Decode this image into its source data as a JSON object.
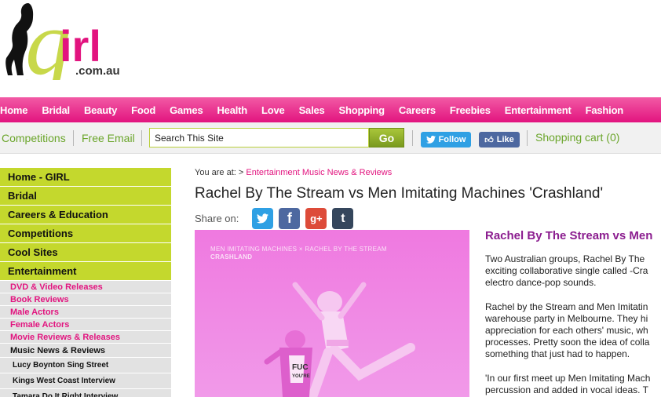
{
  "logo": {
    "letters": "girl",
    "domain": ".com.au",
    "icon": "silhouette-logo-icon"
  },
  "main_nav": [
    "Home",
    "Bridal",
    "Beauty",
    "Food",
    "Games",
    "Health",
    "Love",
    "Sales",
    "Shopping",
    "Careers",
    "Freebies",
    "Entertainment",
    "Fashion"
  ],
  "secondary": {
    "competitions": "Competitions",
    "free_email": "Free Email",
    "search_value": "Search This Site",
    "go": "Go",
    "twitter": "Follow",
    "facebook": "Like",
    "cart": "Shopping cart (0)"
  },
  "sidebar": {
    "items": [
      "Home - GIRL",
      "Bridal",
      "Careers & Education",
      "Competitions",
      "Cool Sites",
      "Entertainment"
    ],
    "sub": [
      "DVD & Video Releases",
      "Book Reviews",
      "Male Actors",
      "Female Actors",
      "Movie Reviews & Releases"
    ],
    "active_sub": "Music News & Reviews",
    "sub2": [
      "Lucy Boynton Sing Street",
      "Kings West Coast Interview",
      "Tamara Do It Right Interview"
    ]
  },
  "breadcrumb": {
    "prefix": "You are at: >",
    "link": "Entertainment Music News & Reviews"
  },
  "article": {
    "title": "Rachel By The Stream vs Men Imitating Machines 'Crashland'",
    "share_label": "Share on:",
    "image_caption_1": "MEN IMITATING MACHINES × RACHEL BY THE STREAM",
    "image_caption_2": "CRASHLAND",
    "image_shirt_text_1": "FUC",
    "image_shirt_text_2": "YOU'RE",
    "side_title": "Rachel By The Stream vs Men",
    "p1": [
      "Two Australian groups, Rachel By The",
      "exciting collaborative single called -Cra",
      "electro dance-pop sounds."
    ],
    "p2": [
      "Rachel by the Stream and Men Imitatin",
      "warehouse party in Melbourne. They hi",
      "appreciation for each others' music, wh",
      "processes. Pretty soon the idea of colla",
      "something that just had to happen."
    ],
    "p3": [
      "'In our first meet up Men Imitating Mach",
      "percussion and added in vocal ideas. T"
    ]
  },
  "colors": {
    "pink": "#e2147f",
    "lime": "#c4d82d",
    "green_link": "#6aa52a",
    "purple_title": "#8b1d8f",
    "twitter": "#2fa0e4",
    "facebook": "#4d68a0",
    "google": "#dd4b39",
    "tumblr": "#35465c"
  }
}
